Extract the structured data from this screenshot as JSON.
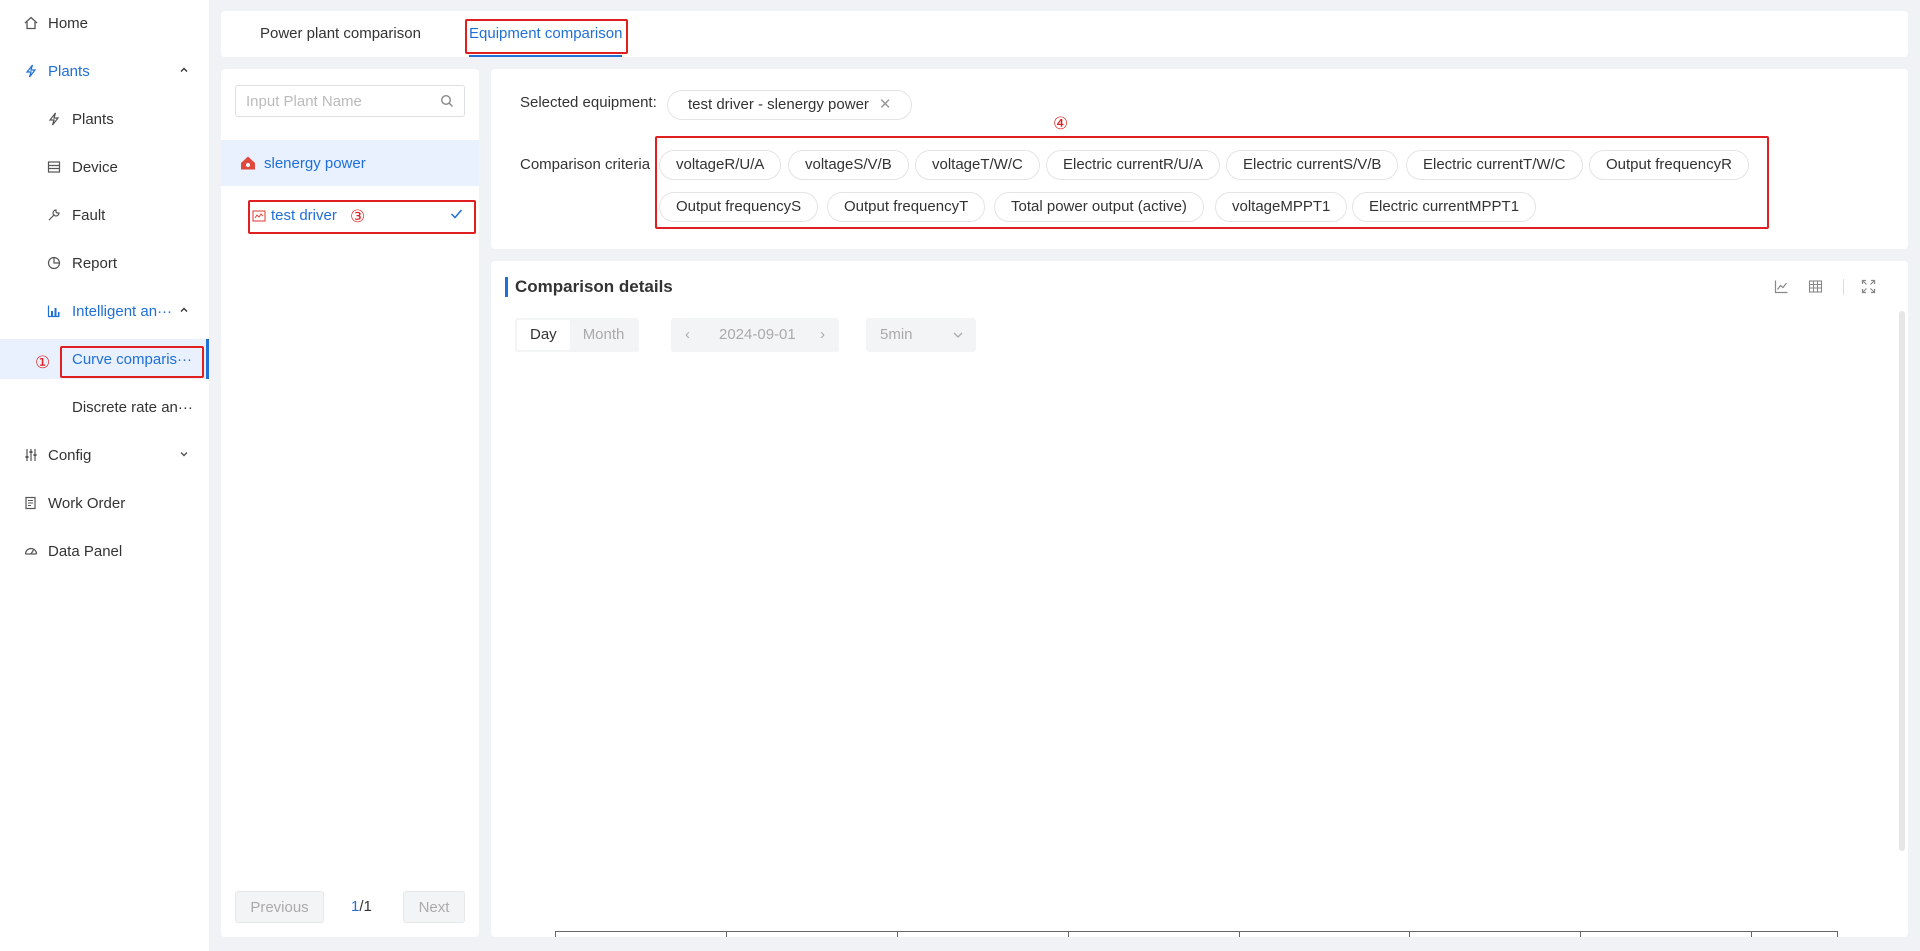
{
  "sidebar": {
    "items": [
      {
        "label": "Home",
        "icon": "home-icon"
      },
      {
        "label": "Plants",
        "icon": "bolt-icon",
        "expanded": true
      },
      {
        "label": "Plants",
        "icon": "bolt-icon"
      },
      {
        "label": "Device",
        "icon": "device-icon"
      },
      {
        "label": "Fault",
        "icon": "wrench-icon"
      },
      {
        "label": "Report",
        "icon": "pie-icon"
      },
      {
        "label": "Intelligent an···",
        "icon": "chart-icon",
        "expanded": true
      },
      {
        "label": "Curve comparis···",
        "selected": true
      },
      {
        "label": "Discrete rate an···"
      },
      {
        "label": "Config",
        "icon": "sliders-icon"
      },
      {
        "label": "Work Order",
        "icon": "order-icon"
      },
      {
        "label": "Data Panel",
        "icon": "gauge-icon"
      }
    ]
  },
  "annotations": {
    "one": "①",
    "three": "③",
    "four": "④"
  },
  "tabs": [
    {
      "label": "Power plant comparison",
      "active": false
    },
    {
      "label": "Equipment comparison",
      "active": true
    }
  ],
  "left_panel": {
    "search_placeholder": "Input Plant Name",
    "plant": "slenergy power",
    "equipment": "test driver",
    "pager": {
      "previous": "Previous",
      "next": "Next",
      "current": "1",
      "total": "/1"
    }
  },
  "criteria": {
    "selected_label": "Selected equipment:",
    "selected_value": "test driver - slenergy power",
    "criteria_label": "Comparison criteria",
    "chips": [
      "voltageR/U/A",
      "voltageS/V/B",
      "voltageT/W/C",
      "Electric currentR/U/A",
      "Electric currentS/V/B",
      "Electric currentT/W/C",
      "Output frequencyR",
      "Output frequencyS",
      "Output frequencyT",
      "Total power output (active)",
      "voltageMPPT1",
      "Electric currentMPPT1"
    ]
  },
  "details": {
    "title": "Comparison details",
    "period_day": "Day",
    "period_month": "Month",
    "date": "2024-09-01",
    "interval": "5min"
  },
  "colors": {
    "accent": "#1f6fd6",
    "annotation": "#e02020",
    "plant_icon": "#e0483e"
  }
}
